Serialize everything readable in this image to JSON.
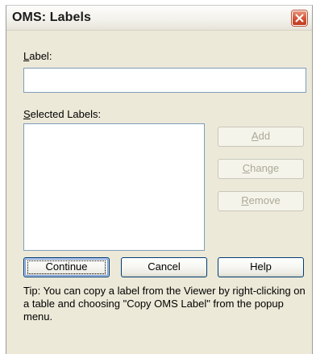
{
  "window": {
    "title": "OMS: Labels",
    "close_icon": "close-x-icon"
  },
  "label_field": {
    "label_prefix": "",
    "label_mnemonic": "L",
    "label_rest": "abel:",
    "value": ""
  },
  "selected_labels": {
    "mnemonic": "S",
    "rest": "elected Labels:",
    "items": []
  },
  "side_buttons": {
    "add_mnemonic": "A",
    "add_rest": "dd",
    "change_mnemonic": "C",
    "change_rest": "hange",
    "remove_mnemonic": "R",
    "remove_rest": "emove"
  },
  "bottom_buttons": {
    "continue": "Continue",
    "cancel": "Cancel",
    "help": "Help"
  },
  "tip": {
    "text": "Tip: You can copy a label from the Viewer by right-clicking on a table and choosing \"Copy OMS Label\" from the popup menu."
  },
  "colors": {
    "dialog_bg": "#ece9d8",
    "field_border": "#7f9db9",
    "disabled_text": "#aca899",
    "close_button": "#d4573b"
  }
}
